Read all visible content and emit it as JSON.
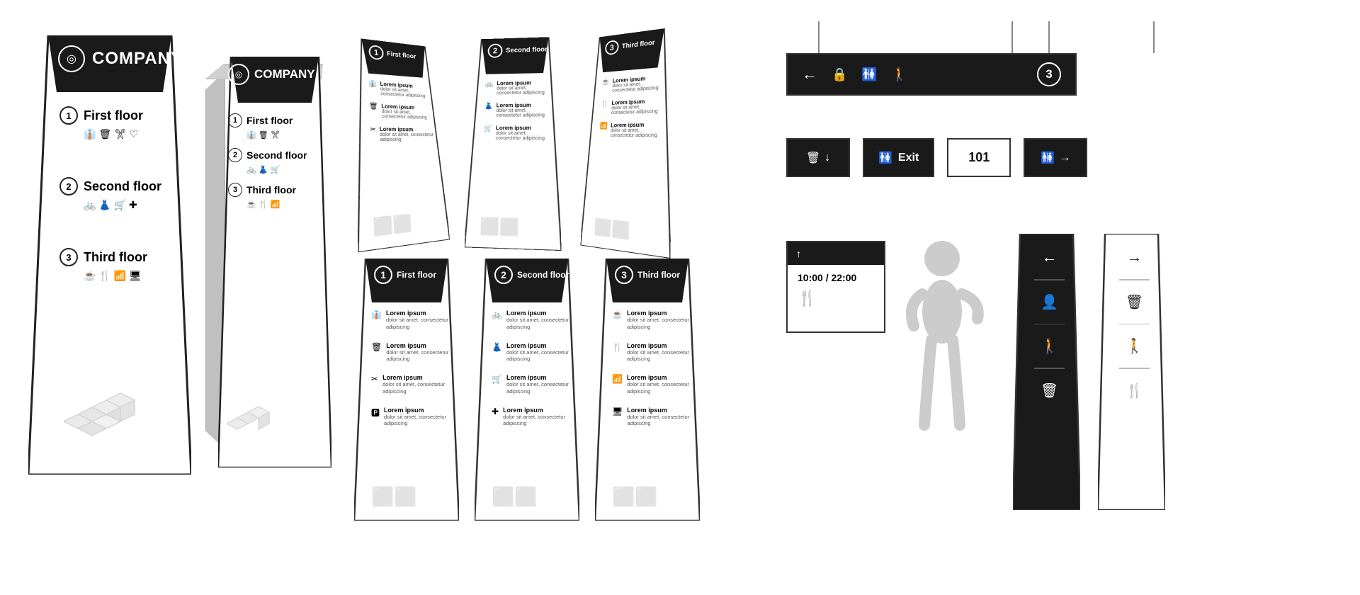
{
  "company": {
    "name": "COMPANY",
    "logo_symbol": "◎"
  },
  "floors": [
    {
      "number": "1",
      "label": "First floor",
      "icons": [
        "👔",
        "🗑",
        "✂",
        "♡"
      ],
      "items": [
        {
          "icon": "👔",
          "title": "Lorem ipsum",
          "body": "dolor sit amet, consectetur adipiscing"
        },
        {
          "icon": "🗑",
          "title": "Lorem ipsum",
          "body": "dolor sit amet, consectetur adipiscing"
        },
        {
          "icon": "✂",
          "title": "Lorem ipsum",
          "body": "dolor sit amet, consectetur adipiscing"
        },
        {
          "icon": "🅿",
          "title": "Lorem ipsum",
          "body": "dolor sit amet, consectetur adipiscing"
        }
      ]
    },
    {
      "number": "2",
      "label": "Second floor",
      "icons": [
        "🚲",
        "👗",
        "🛒",
        "✚"
      ],
      "items": [
        {
          "icon": "🚲",
          "title": "Lorem ipsum",
          "body": "dolor sit amet, consectetur adipiscing"
        },
        {
          "icon": "👗",
          "title": "Lorem ipsum",
          "body": "dolor sit amet, consectetur adipiscing"
        },
        {
          "icon": "🛒",
          "title": "Lorem ipsum",
          "body": "dolor sit amet, consectetur adipiscing"
        },
        {
          "icon": "✚",
          "title": "Lorem ipsum",
          "body": "dolor sit amet, consectetur adipiscing"
        }
      ]
    },
    {
      "number": "3",
      "label": "Third floor",
      "icons": [
        "☕",
        "🍴",
        "📶",
        "🖥"
      ],
      "items": [
        {
          "icon": "☕",
          "title": "Lorem ipsum",
          "body": "dolor sit amet, consectetur adipiscing"
        },
        {
          "icon": "🍴",
          "title": "Lorem ipsum",
          "body": "dolor sit amet, consectetur adipiscing"
        },
        {
          "icon": "📶",
          "title": "Lorem ipsum",
          "body": "dolor sit amet, consectetur adipiscing"
        },
        {
          "icon": "🖥",
          "title": "Lorem ipsum",
          "body": "dolor sit amet, consectetur adipiscing"
        }
      ]
    }
  ],
  "wayfinding": {
    "hanging_sign": {
      "arrow": "←",
      "icons": [
        "🔒",
        "🚻",
        "🚶"
      ],
      "number": "3"
    },
    "wall_signs": [
      {
        "icon": "🗑",
        "arrow": "↓",
        "bg": "dark"
      },
      {
        "icon": "🚻",
        "label": "Exit",
        "bg": "dark"
      },
      {
        "label": "101",
        "bg": "light"
      },
      {
        "icon": "🚻",
        "arrow": "→",
        "bg": "dark"
      }
    ],
    "hours": "10:00 / 22:00",
    "hours_icon": "🍴",
    "pillar_left": [
      "←"
    ],
    "pillar_right": [
      "→"
    ],
    "pillar_left_icons": [
      "👤",
      "🚶",
      "🗑"
    ],
    "pillar_right_icons": [
      "🗑",
      "🚶",
      "🍴"
    ]
  }
}
